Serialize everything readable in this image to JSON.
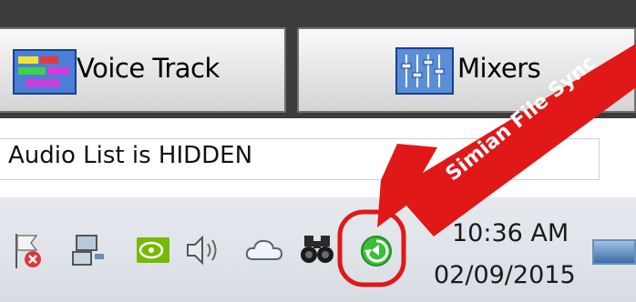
{
  "toolbar": {
    "voice_track_label": "Voice Track",
    "mixers_label": "Mixers"
  },
  "status": {
    "text": "Audio List is HIDDEN"
  },
  "taskbar": {
    "time": "10:36 AM",
    "date": "02/09/2015",
    "icons": [
      "action-center-flag-icon",
      "network-icon",
      "nvidia-icon",
      "volume-icon",
      "cloud-icon",
      "binoculars-icon",
      "simian-sync-icon"
    ]
  },
  "annotation": {
    "label": "Simian File Sync",
    "color": "#e01818"
  }
}
